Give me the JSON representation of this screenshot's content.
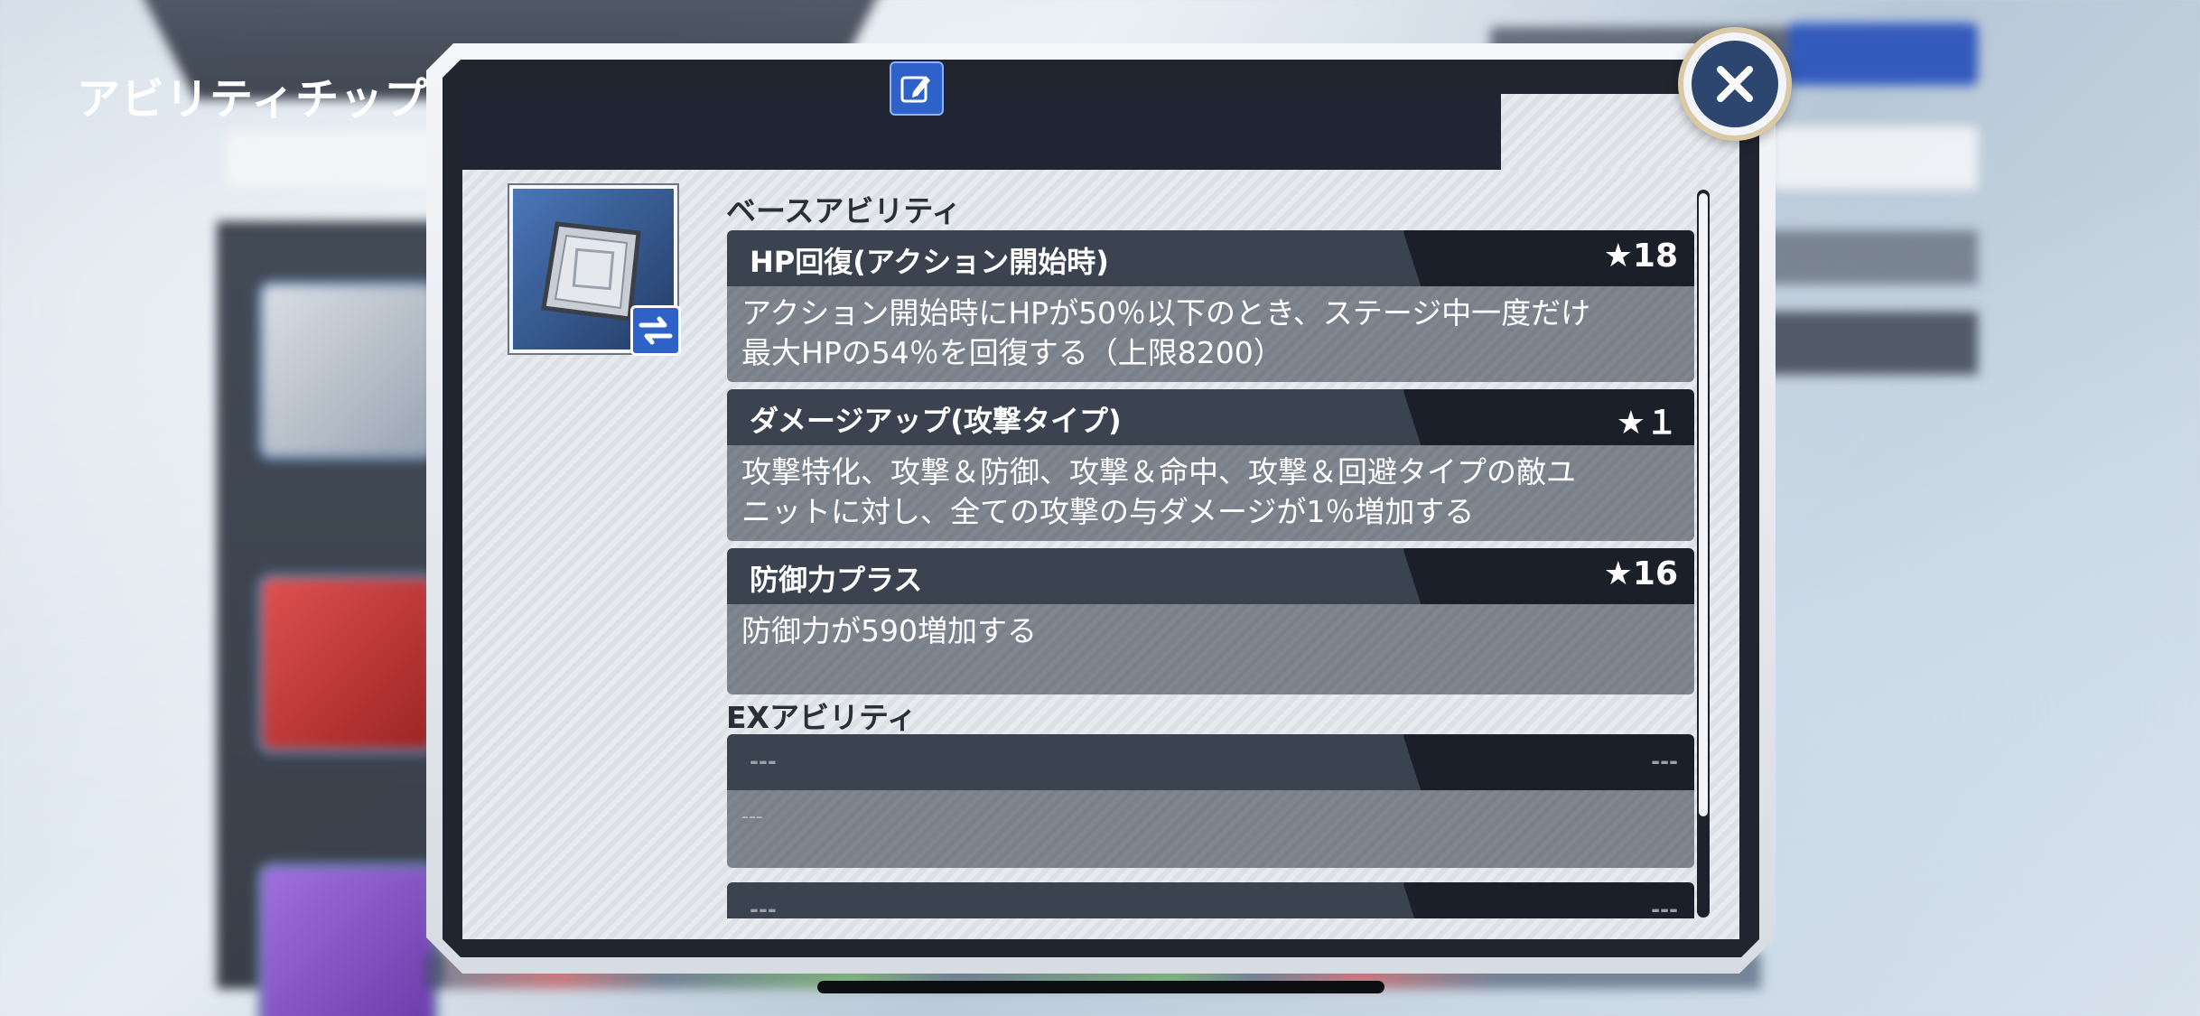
{
  "dialog": {
    "title": "アビリティチップ",
    "edit_icon": "edit-icon",
    "close_icon": "close-icon",
    "chip_icon": "ability-chip-icon",
    "swap_icon": "swap-arrows-icon"
  },
  "sections": {
    "base_label": "ベースアビリティ",
    "ex_label": "EXアビリティ"
  },
  "base_abilities": [
    {
      "name": "HP回復(アクション開始時)",
      "rank": "★18",
      "desc_line1": "アクション開始時にHPが50％以下のとき、ステージ中一度だけ",
      "desc_line2": "最大HPの54％を回復する（上限8200）"
    },
    {
      "name": "ダメージアップ(攻撃タイプ)",
      "rank": "★１",
      "desc_line1": "攻撃特化、攻撃＆防御、攻撃＆命中、攻撃＆回避タイプの敵ユ",
      "desc_line2": "ニットに対し、全ての攻撃の与ダメージが1％増加する"
    },
    {
      "name": "防御力プラス",
      "rank": "★16",
      "desc_line1": "防御力が590増加する",
      "desc_line2": ""
    }
  ],
  "ex_abilities": [
    {
      "name": "---",
      "rank": "---",
      "desc": "---"
    },
    {
      "name": "---",
      "rank": "---",
      "desc": ""
    }
  ],
  "colors": {
    "header_bg": "#1f2532",
    "accent_blue": "#2f62c9",
    "close_disc": "#2d4670"
  }
}
